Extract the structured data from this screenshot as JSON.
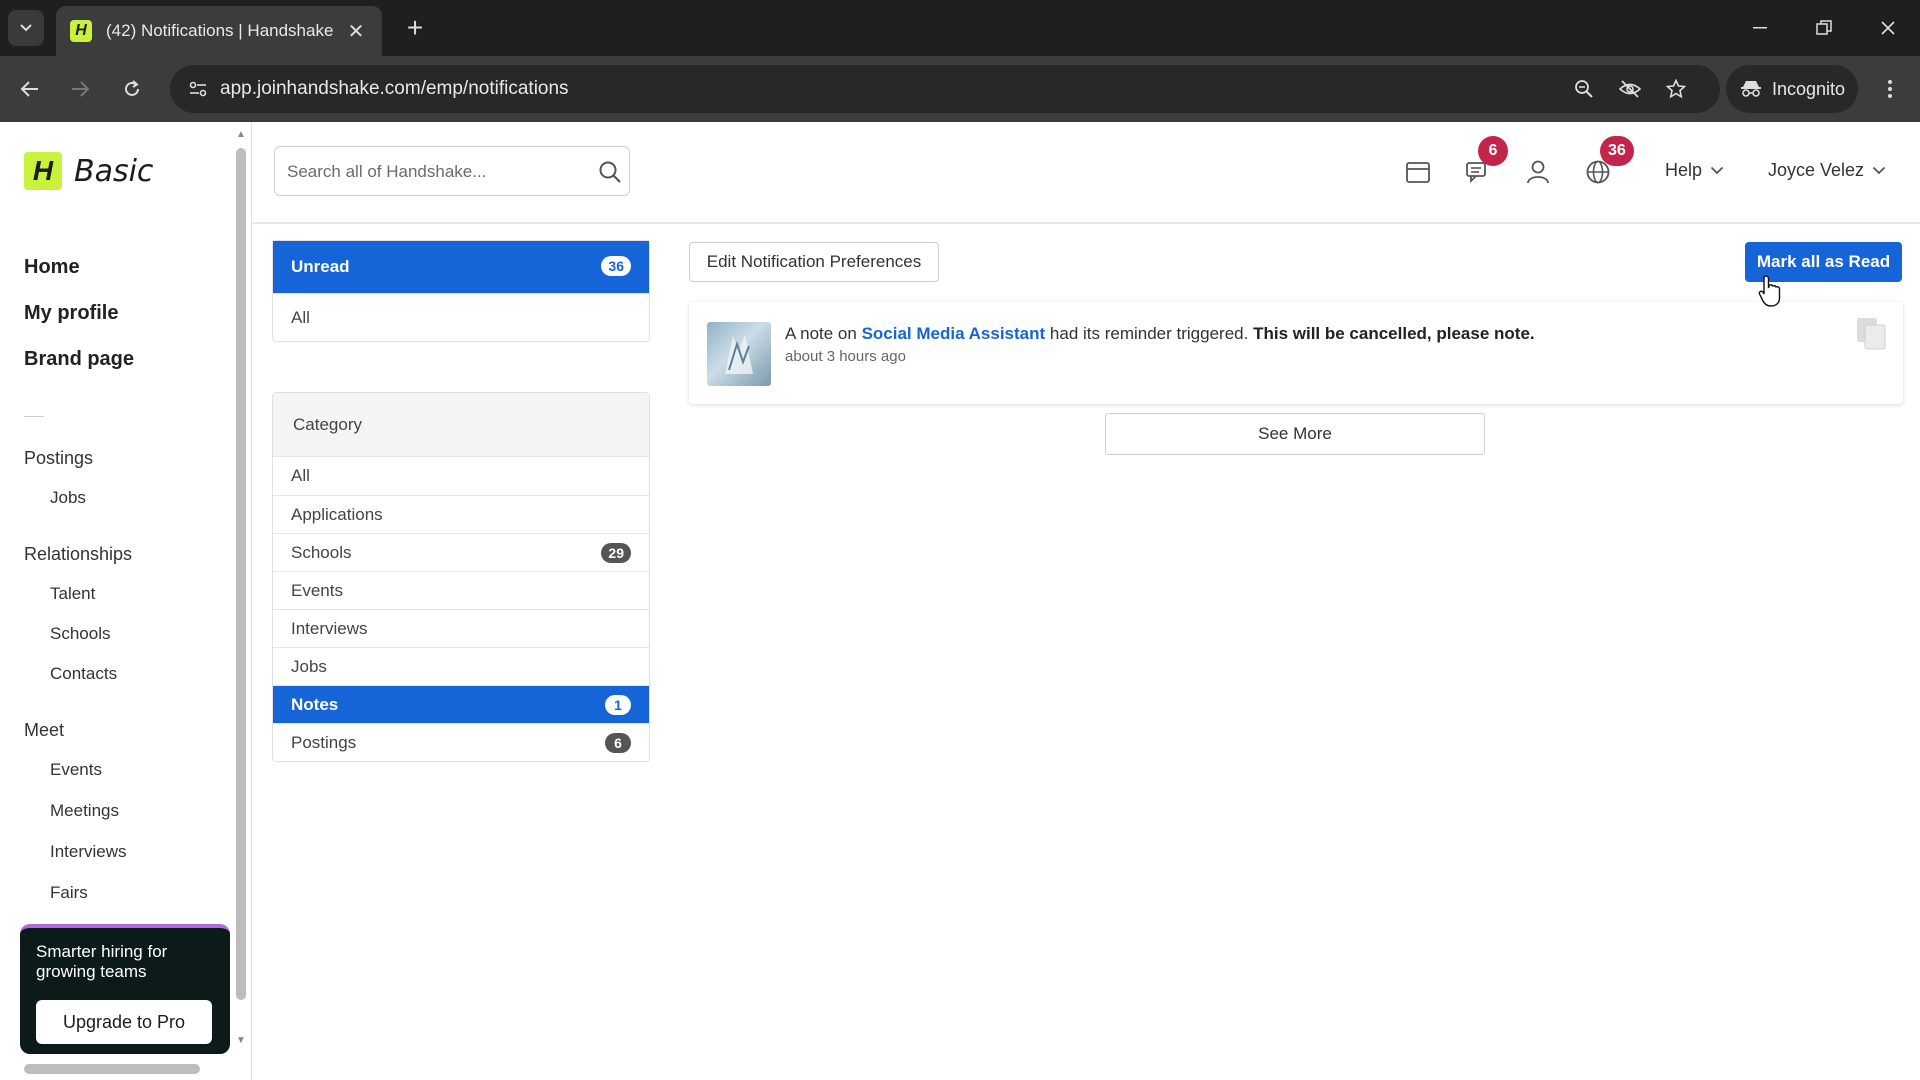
{
  "browser": {
    "tab_title": "(42) Notifications | Handshake",
    "favicon_letter": "H",
    "url": "app.joinhandshake.com/emp/notifications",
    "incognito_label": "Incognito"
  },
  "sidebar": {
    "logo_letter": "H",
    "plan": "Basic",
    "main_nav": [
      "Home",
      "My profile",
      "Brand page"
    ],
    "sections": [
      {
        "title": "Postings",
        "items": [
          "Jobs"
        ]
      },
      {
        "title": "Relationships",
        "items": [
          "Talent",
          "Schools",
          "Contacts"
        ]
      },
      {
        "title": "Meet",
        "items": [
          "Events",
          "Meetings",
          "Interviews",
          "Fairs"
        ]
      }
    ],
    "promo_text": "Smarter hiring for growing teams",
    "promo_button": "Upgrade to Pro"
  },
  "header": {
    "search_placeholder": "Search all of Handshake...",
    "messages_badge": "6",
    "notifications_badge": "36",
    "help_label": "Help",
    "user_name": "Joyce Velez"
  },
  "filters": {
    "unread_label": "Unread",
    "unread_count": "36",
    "all_label": "All",
    "category_title": "Category",
    "categories": [
      {
        "label": "All",
        "count": ""
      },
      {
        "label": "Applications",
        "count": ""
      },
      {
        "label": "Schools",
        "count": "29"
      },
      {
        "label": "Events",
        "count": ""
      },
      {
        "label": "Interviews",
        "count": ""
      },
      {
        "label": "Jobs",
        "count": ""
      },
      {
        "label": "Notes",
        "count": "1"
      },
      {
        "label": "Postings",
        "count": "6"
      }
    ]
  },
  "main": {
    "edit_prefs_label": "Edit Notification Preferences",
    "mark_all_label": "Mark all as Read",
    "notification": {
      "prefix": "A note on ",
      "link": "Social Media Assistant",
      "middle": " had its reminder triggered. ",
      "emphasis": "This will be cancelled, please note.",
      "time": "about 3 hours ago"
    },
    "see_more_label": "See More"
  },
  "colors": {
    "brand_lime": "#c8f23c",
    "primary_blue": "#1565d8",
    "badge_red": "#c3244a"
  }
}
